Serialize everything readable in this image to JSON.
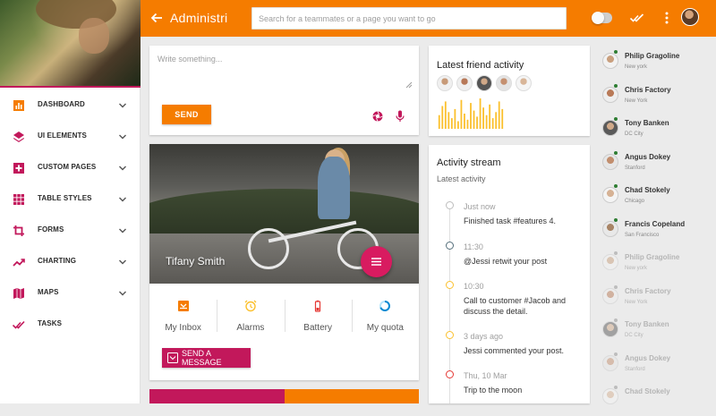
{
  "colors": {
    "primary": "#f57c00",
    "accent": "#c2185b",
    "online": "#2e7d32",
    "offline": "#bdbdbd"
  },
  "topbar": {
    "title": "Administri",
    "search_placeholder": "Search for a teammates or a page you want to go",
    "icons": [
      "arrow-back-icon",
      "toggle-switch",
      "done-all-icon",
      "more-vert-icon",
      "avatar"
    ]
  },
  "sidebar": {
    "items": [
      {
        "label": "DASHBOARD",
        "icon": "bar-chart-icon"
      },
      {
        "label": "UI ELEMENTS",
        "icon": "layers-icon"
      },
      {
        "label": "CUSTOM PAGES",
        "icon": "plus-box-icon"
      },
      {
        "label": "TABLE STYLES",
        "icon": "grid-icon"
      },
      {
        "label": "FORMS",
        "icon": "crop-icon"
      },
      {
        "label": "CHARTING",
        "icon": "trending-up-icon"
      },
      {
        "label": "MAPS",
        "icon": "map-icon"
      },
      {
        "label": "TASKS",
        "icon": "done-all-icon"
      }
    ]
  },
  "composer": {
    "placeholder": "Write something...",
    "send_label": "SEND"
  },
  "profile": {
    "name": "Tifany Smith",
    "stats": [
      {
        "label": "My Inbox",
        "icon": "inbox-icon",
        "color": "#f57c00"
      },
      {
        "label": "Alarms",
        "icon": "alarm-icon",
        "color": "#fbc02d"
      },
      {
        "label": "Battery",
        "icon": "battery-icon",
        "color": "#e53935"
      },
      {
        "label": "My quota",
        "icon": "donut-icon",
        "color": "#0288d1"
      }
    ],
    "message_button": "SEND A MESSAGE"
  },
  "friend_activity": {
    "title": "Latest friend activity",
    "avatar_count": 5,
    "bar_values": [
      0.45,
      0.75,
      0.9,
      0.55,
      0.35,
      0.65,
      0.25,
      0.95,
      0.5,
      0.3,
      0.85,
      0.6,
      0.4,
      1.0,
      0.7,
      0.45,
      0.8,
      0.35,
      0.55,
      0.9,
      0.65
    ],
    "bar_color": "#fbc02d"
  },
  "activity_stream": {
    "title": "Activity stream",
    "subtitle": "Latest activity",
    "items": [
      {
        "time": "Just now",
        "text": "Finished task #features 4.",
        "color": "#bdbdbd"
      },
      {
        "time": "11:30",
        "text": "@Jessi retwit your post",
        "color": "#546e7a"
      },
      {
        "time": "10:30",
        "text": "Call to customer #Jacob and discuss the detail.",
        "color": "#fbc02d"
      },
      {
        "time": "3 days ago",
        "text": "Jessi commented your post.",
        "color": "#fbc02d"
      },
      {
        "time": "Thu, 10 Mar",
        "text": "Trip to the moon",
        "color": "#e53935"
      }
    ]
  },
  "contacts": [
    {
      "name": "Philip Gragoline",
      "location": "New york",
      "online": true
    },
    {
      "name": "Chris Factory",
      "location": "New York",
      "online": true
    },
    {
      "name": "Tony Banken",
      "location": "DC City",
      "online": true
    },
    {
      "name": "Angus Dokey",
      "location": "Stanford",
      "online": true
    },
    {
      "name": "Chad Stokely",
      "location": "Chicago",
      "online": true
    },
    {
      "name": "Francis Copeland",
      "location": "San Francisco",
      "online": true
    },
    {
      "name": "Philip Gragoline",
      "location": "New york",
      "online": false
    },
    {
      "name": "Chris Factory",
      "location": "New York",
      "online": false
    },
    {
      "name": "Tony Banken",
      "location": "DC City",
      "online": false
    },
    {
      "name": "Angus Dokey",
      "location": "Stanford",
      "online": false
    },
    {
      "name": "Chad Stokely",
      "location": "Chicago",
      "online": false
    }
  ]
}
